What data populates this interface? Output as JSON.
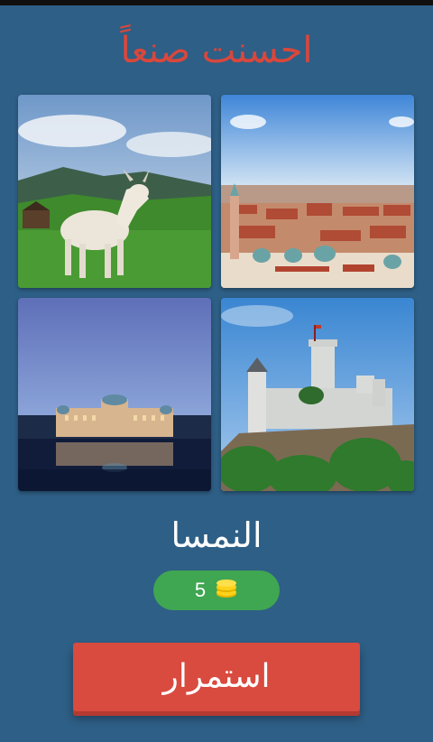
{
  "header": {
    "title": "احسنت صنعاً"
  },
  "images": [
    {
      "subject": "goat"
    },
    {
      "subject": "city"
    },
    {
      "subject": "palace"
    },
    {
      "subject": "castle"
    }
  ],
  "answer": {
    "word": "النمسا"
  },
  "coins": {
    "count": "5",
    "icon": "coins-icon"
  },
  "actions": {
    "continue_label": "استمرار"
  },
  "colors": {
    "background": "#2e5f86",
    "title": "#d9473c",
    "coin_pill": "#3fa652",
    "continue_button": "#d94a3f"
  }
}
